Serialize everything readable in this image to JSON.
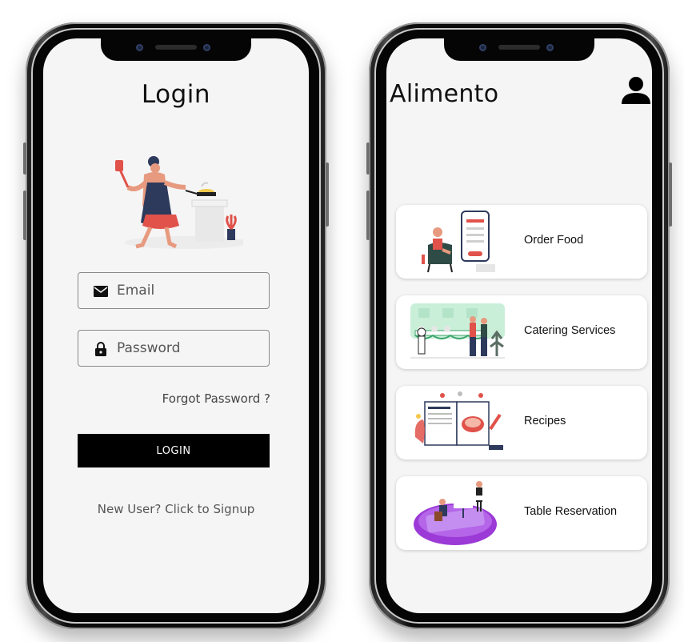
{
  "login_screen": {
    "title": "Login",
    "email_label": "Email",
    "password_label": "Password",
    "forgot_password": "Forgot Password ?",
    "login_button": "LOGIN",
    "signup_text": "New User? Click to Signup",
    "icons": [
      "mail-icon",
      "lock-icon"
    ]
  },
  "home_screen": {
    "title": "Alimento",
    "profile_icon": "person-icon",
    "cards": [
      {
        "label": "Order Food"
      },
      {
        "label": "Catering Services"
      },
      {
        "label": "Recipes"
      },
      {
        "label": "Table Reservation"
      }
    ]
  },
  "colors": {
    "screen_background": "#f5f5f5",
    "button": "#000000",
    "button_text": "#ffffff",
    "accent_red": "#e0524a",
    "accent_purple": "#9b3ad6"
  }
}
